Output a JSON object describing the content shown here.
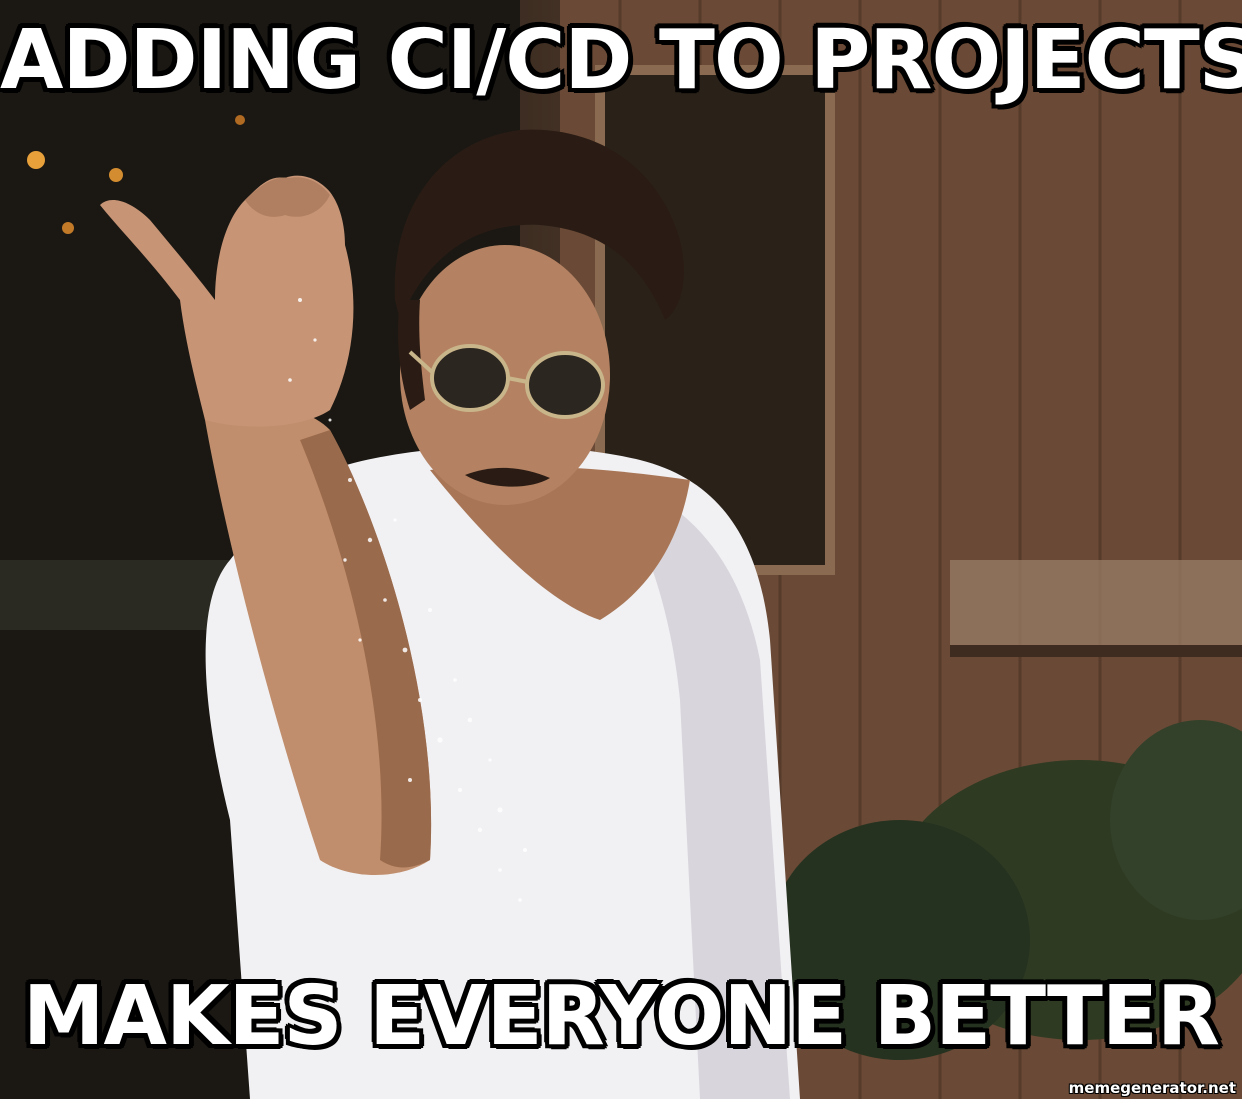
{
  "meme": {
    "top_text": "ADDING CI/CD TO PROJECTS",
    "bottom_text": "MAKES EVERYONE BETTER",
    "watermark": "memegenerator.net"
  },
  "colors": {
    "caption_fill": "#ffffff",
    "caption_outline": "#000000",
    "shirt": "#f2f2f4",
    "skin": "#b98866",
    "wood_wall": "#6e4e38",
    "dark_background": "#1c1812"
  }
}
